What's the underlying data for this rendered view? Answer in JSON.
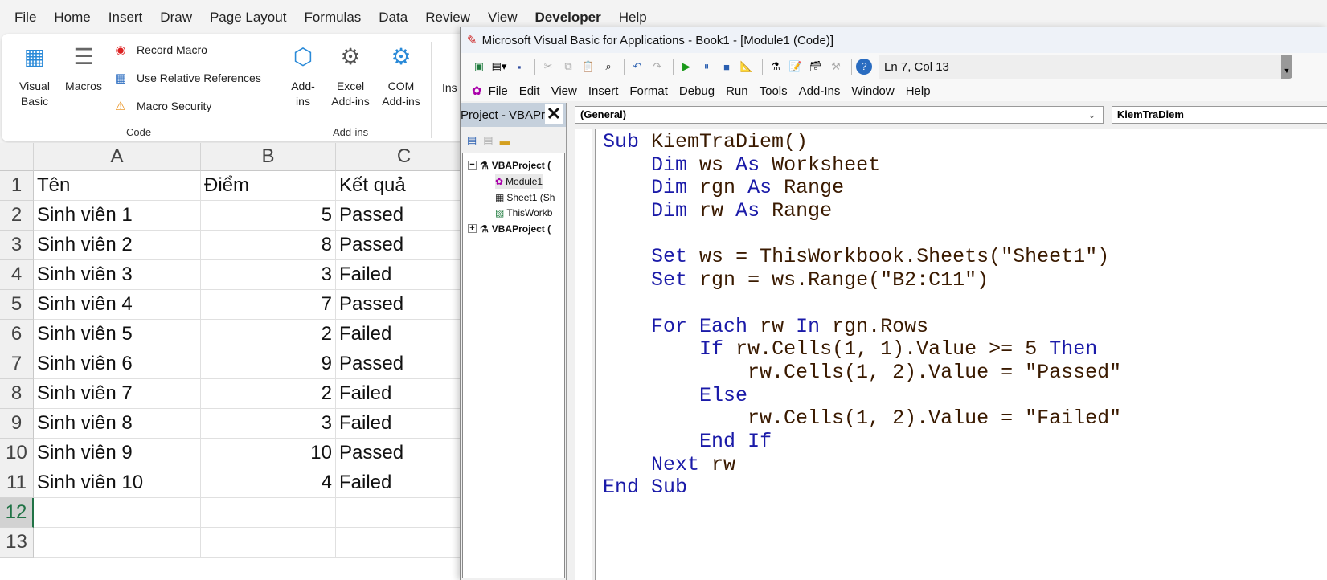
{
  "excel": {
    "tabs": [
      "File",
      "Home",
      "Insert",
      "Draw",
      "Page Layout",
      "Formulas",
      "Data",
      "Review",
      "View",
      "Developer",
      "Help"
    ],
    "active_tab": "Developer",
    "ribbon": {
      "visual_basic": [
        "Visual",
        "Basic"
      ],
      "macros": "Macros",
      "record_macro": "Record Macro",
      "use_relative": "Use Relative References",
      "macro_security": "Macro Security",
      "code_group": "Code",
      "addins": [
        "Add-",
        "ins"
      ],
      "excel_addins": [
        "Excel",
        "Add-ins"
      ],
      "com_addins": [
        "COM",
        "Add-ins"
      ],
      "addins_group": "Add-ins",
      "insert_partial": "Ins"
    },
    "columns": [
      "A",
      "B",
      "C"
    ],
    "rows": [
      {
        "n": "1",
        "a": "Tên",
        "b": "Điểm",
        "c": "Kết quả"
      },
      {
        "n": "2",
        "a": "Sinh viên 1",
        "b": "5",
        "c": "Passed"
      },
      {
        "n": "3",
        "a": "Sinh viên 2",
        "b": "8",
        "c": "Passed"
      },
      {
        "n": "4",
        "a": "Sinh viên 3",
        "b": "3",
        "c": "Failed"
      },
      {
        "n": "5",
        "a": "Sinh viên 4",
        "b": "7",
        "c": "Passed"
      },
      {
        "n": "6",
        "a": "Sinh viên 5",
        "b": "2",
        "c": "Failed"
      },
      {
        "n": "7",
        "a": "Sinh viên 6",
        "b": "9",
        "c": "Passed"
      },
      {
        "n": "8",
        "a": "Sinh viên 7",
        "b": "2",
        "c": "Failed"
      },
      {
        "n": "9",
        "a": "Sinh viên 8",
        "b": "3",
        "c": "Failed"
      },
      {
        "n": "10",
        "a": "Sinh viên 9",
        "b": "10",
        "c": "Passed"
      },
      {
        "n": "11",
        "a": "Sinh viên 10",
        "b": "4",
        "c": "Failed"
      },
      {
        "n": "12",
        "a": "",
        "b": "",
        "c": ""
      },
      {
        "n": "13",
        "a": "",
        "b": "",
        "c": ""
      }
    ]
  },
  "vba": {
    "title": "Microsoft Visual Basic for Applications - Book1 - [Module1 (Code)]",
    "position": "Ln 7, Col 13",
    "menu": [
      "File",
      "Edit",
      "View",
      "Insert",
      "Format",
      "Debug",
      "Run",
      "Tools",
      "Add-Ins",
      "Window",
      "Help"
    ],
    "project_title": "Project - VBAPro",
    "tree": [
      "VBAProject (",
      "Module1",
      "Sheet1 (Sh",
      "ThisWorkb",
      "VBAProject ("
    ],
    "object_dropdown": "(General)",
    "proc_dropdown": "KiemTraDiem",
    "code": [
      "Sub KiemTraDiem()",
      "    Dim ws As Worksheet",
      "    Dim rgn As Range",
      "    Dim rw As Range",
      "",
      "    Set ws = ThisWorkbook.Sheets(\"Sheet1\")",
      "    Set rgn = ws.Range(\"B2:C11\")",
      "",
      "    For Each rw In rgn.Rows",
      "        If rw.Cells(1, 1).Value >= 5 Then",
      "            rw.Cells(1, 2).Value = \"Passed\"",
      "        Else",
      "            rw.Cells(1, 2).Value = \"Failed\"",
      "        End If",
      "    Next rw",
      "End Sub"
    ]
  },
  "colors": {
    "keyword": "#1a1aa8",
    "identifier": "#3a1a00",
    "active_row": "#217346"
  }
}
